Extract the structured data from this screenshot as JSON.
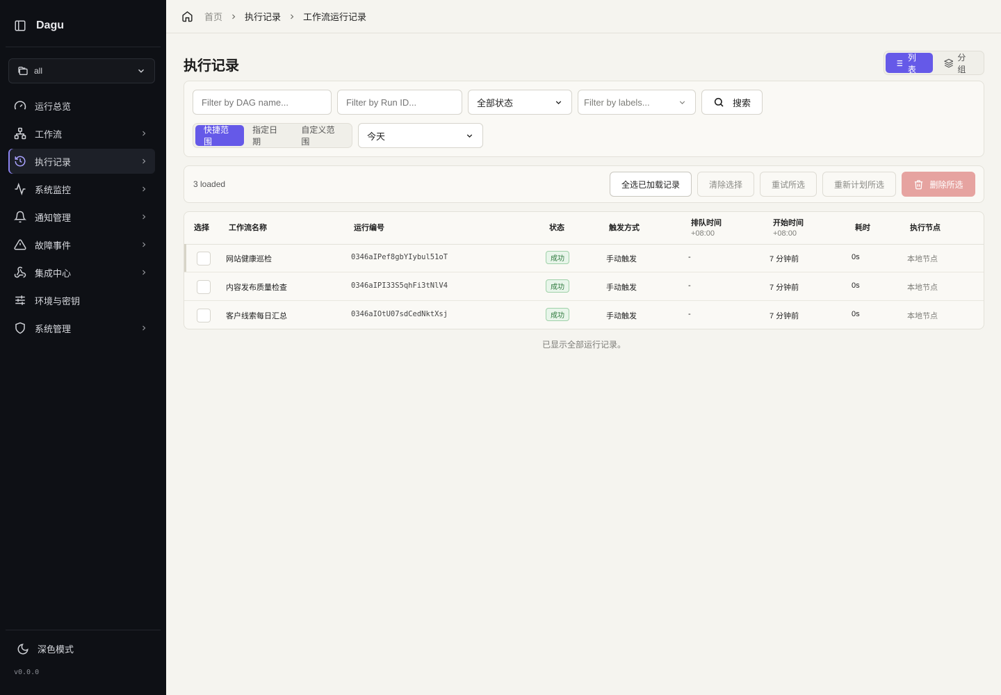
{
  "app": {
    "brand": "Dagu",
    "version": "v0.0.0"
  },
  "sidebar": {
    "namespace": "all",
    "items": [
      {
        "label": "运行总览",
        "icon": "gauge-icon",
        "chevron": false
      },
      {
        "label": "工作流",
        "icon": "workflow-icon",
        "chevron": true
      },
      {
        "label": "执行记录",
        "icon": "history-icon",
        "chevron": true,
        "active": true
      },
      {
        "label": "系统监控",
        "icon": "activity-icon",
        "chevron": true
      },
      {
        "label": "通知管理",
        "icon": "bell-icon",
        "chevron": true
      },
      {
        "label": "故障事件",
        "icon": "alert-icon",
        "chevron": true
      },
      {
        "label": "集成中心",
        "icon": "webhook-icon",
        "chevron": true
      },
      {
        "label": "环境与密钥",
        "icon": "sliders-icon",
        "chevron": false
      },
      {
        "label": "系统管理",
        "icon": "shield-icon",
        "chevron": true
      }
    ],
    "dark_mode_label": "深色模式"
  },
  "breadcrumb": {
    "home": "首页",
    "section": "执行记录",
    "current": "工作流运行记录"
  },
  "page": {
    "title": "执行记录"
  },
  "view_toggle": {
    "list": "列表",
    "group": "分组"
  },
  "filters": {
    "dag_placeholder": "Filter by DAG name...",
    "run_placeholder": "Filter by Run ID...",
    "status": "全部状态",
    "labels_placeholder": "Filter by labels...",
    "search": "搜索",
    "range_tabs": [
      "快捷范围",
      "指定日期",
      "自定义范围"
    ],
    "range_value": "今天"
  },
  "actions": {
    "loaded": "3 loaded",
    "select_all": "全选已加载记录",
    "clear": "清除选择",
    "retry": "重试所选",
    "reschedule": "重新计划所选",
    "delete": "删除所选"
  },
  "table": {
    "headers": {
      "select": "选择",
      "name": "工作流名称",
      "run_id": "运行编号",
      "status": "状态",
      "trigger": "触发方式",
      "queued": "排队时间",
      "queued_tz": "+08:00",
      "started": "开始时间",
      "started_tz": "+08:00",
      "duration": "耗时",
      "node": "执行节点"
    },
    "rows": [
      {
        "name": "网站健康巡检",
        "run_id": "0346aIPef8gbYIybul51oT",
        "status": "成功",
        "trigger": "手动触发",
        "queued": "-",
        "started": "7 分钟前",
        "duration": "0s",
        "node": "本地节点"
      },
      {
        "name": "内容发布质量检查",
        "run_id": "0346aIPI33S5qhFi3tNlV4",
        "status": "成功",
        "trigger": "手动触发",
        "queued": "-",
        "started": "7 分钟前",
        "duration": "0s",
        "node": "本地节点"
      },
      {
        "name": "客户线索每日汇总",
        "run_id": "0346aIOtU07sdCedNktXsj",
        "status": "成功",
        "trigger": "手动触发",
        "queued": "-",
        "started": "7 分钟前",
        "duration": "0s",
        "node": "本地节点"
      }
    ],
    "footer": "已显示全部运行记录。"
  },
  "colors": {
    "accent": "#6559e8",
    "sidebar_bg": "#0e1015",
    "page_bg": "#f5f4ef",
    "success": "#2f7a3e",
    "danger": "#e6a3a0"
  }
}
